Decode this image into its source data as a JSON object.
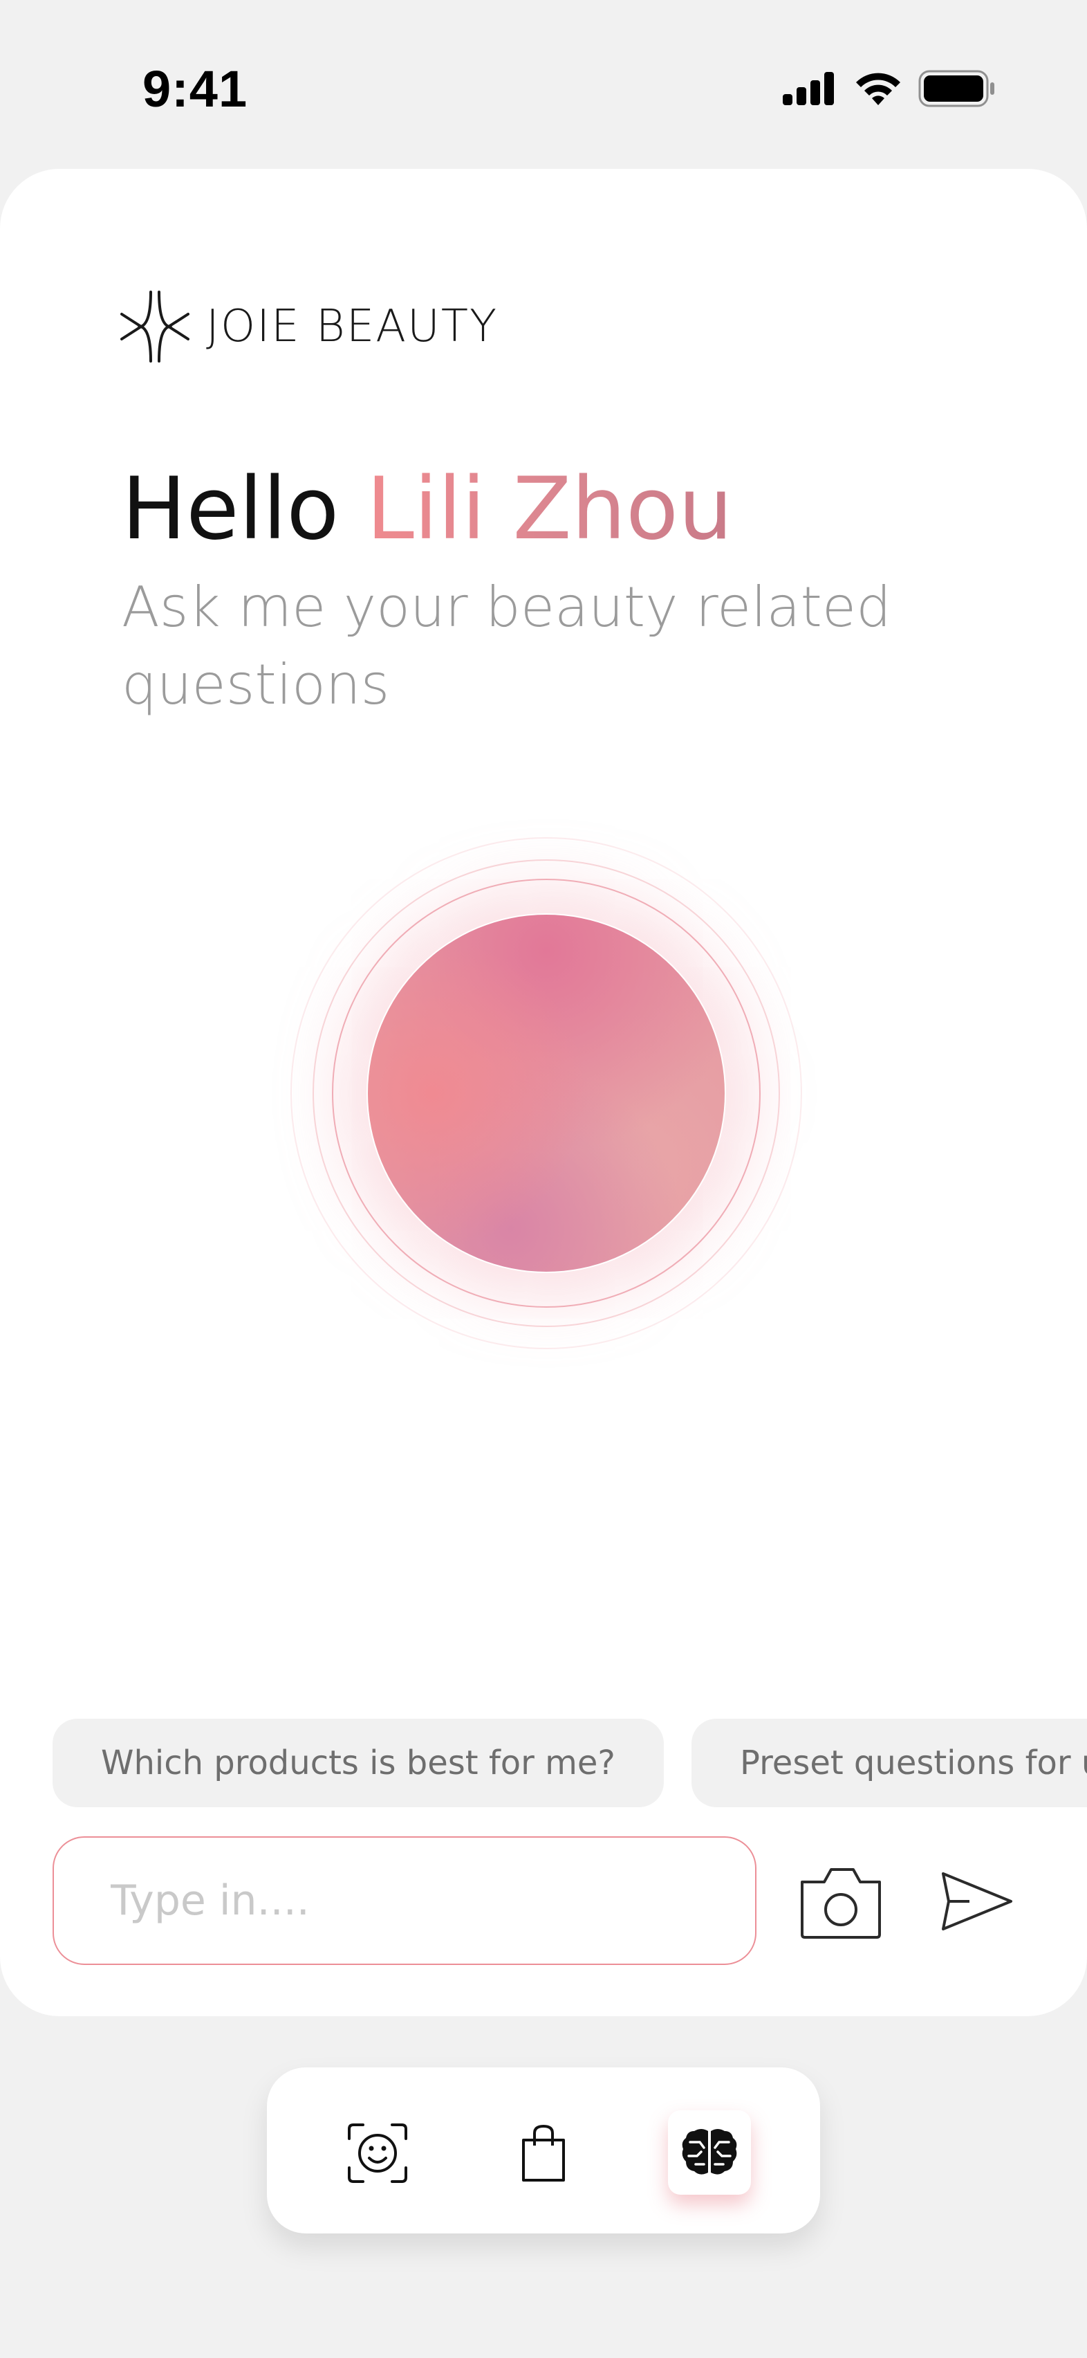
{
  "status_bar": {
    "time": "9:41",
    "icons": [
      "cellular-signal-icon",
      "wifi-icon",
      "battery-icon"
    ]
  },
  "brand": {
    "name": "JOIE BEAUTY",
    "logo": "joie-beauty-logo"
  },
  "greeting": {
    "hello": "Hello ",
    "user_name": "Lili Zhou"
  },
  "subtitle": "Ask me your beauty related questions",
  "suggestions": [
    "Which products is best for me?",
    "Preset questions for u"
  ],
  "input": {
    "placeholder": "Type in....",
    "value": ""
  },
  "actions": {
    "camera": "camera-icon",
    "send": "send-icon"
  },
  "bottom_nav": [
    {
      "icon": "face-scan-icon",
      "active": false
    },
    {
      "icon": "shopping-bag-icon",
      "active": false
    },
    {
      "icon": "ai-brain-icon",
      "active": true
    }
  ],
  "colors": {
    "accent": "#ec8f97",
    "accent_dark": "#c97a88",
    "background": "#f1f1f1"
  }
}
